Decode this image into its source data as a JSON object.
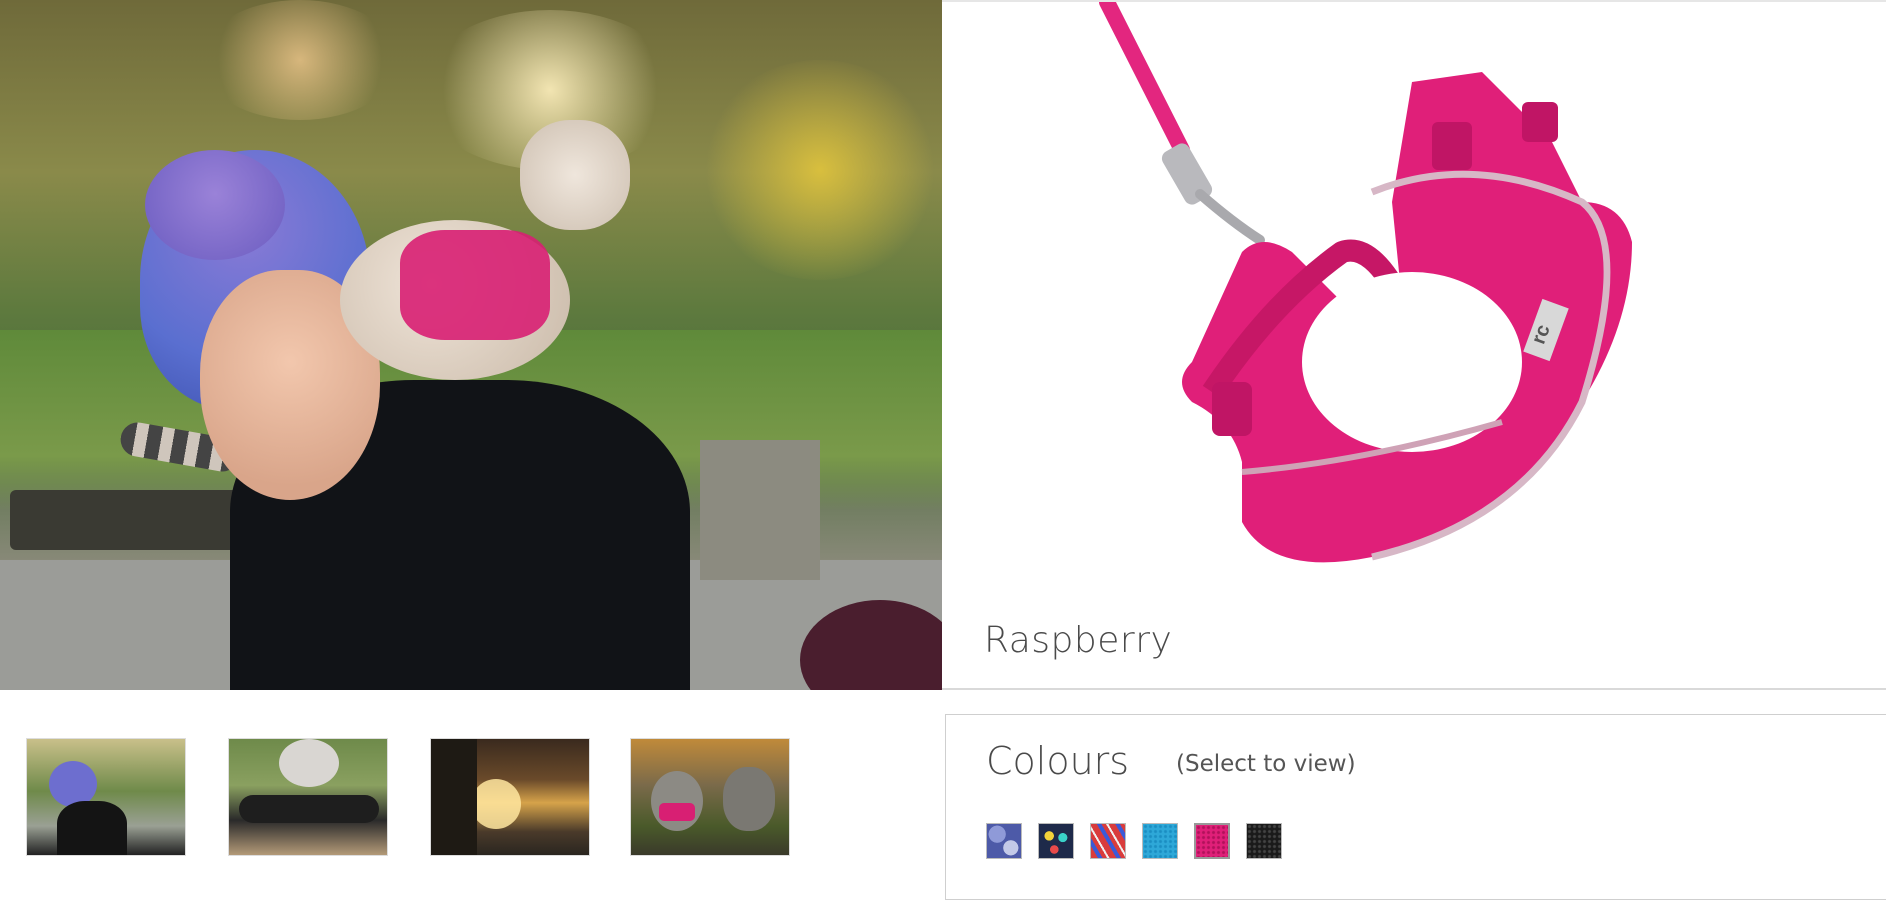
{
  "hero": {
    "alt": "Woman with blue hair and a cat wearing a raspberry harness on her shoulder"
  },
  "product": {
    "variant_name": "Raspberry",
    "harness_color": "#e01f79",
    "badge_text": "rc"
  },
  "thumbnails": [
    {
      "name": "thumb-woman-with-cat"
    },
    {
      "name": "thumb-person-on-bench-with-cat"
    },
    {
      "name": "thumb-forest-walk"
    },
    {
      "name": "thumb-two-cats"
    }
  ],
  "colours": {
    "title": "Colours",
    "hint": "(Select to view)",
    "selected": "Raspberry",
    "swatches": [
      {
        "name": "camo-purple",
        "color": "#4d5aa8"
      },
      {
        "name": "splash-navy",
        "color": "#1e2a4a"
      },
      {
        "name": "stripe-red-blue",
        "color": "#d93c3c"
      },
      {
        "name": "blue",
        "color": "#2ea8d8"
      },
      {
        "name": "raspberry",
        "color": "#e01f79"
      },
      {
        "name": "black",
        "color": "#1a1a1a"
      }
    ]
  }
}
